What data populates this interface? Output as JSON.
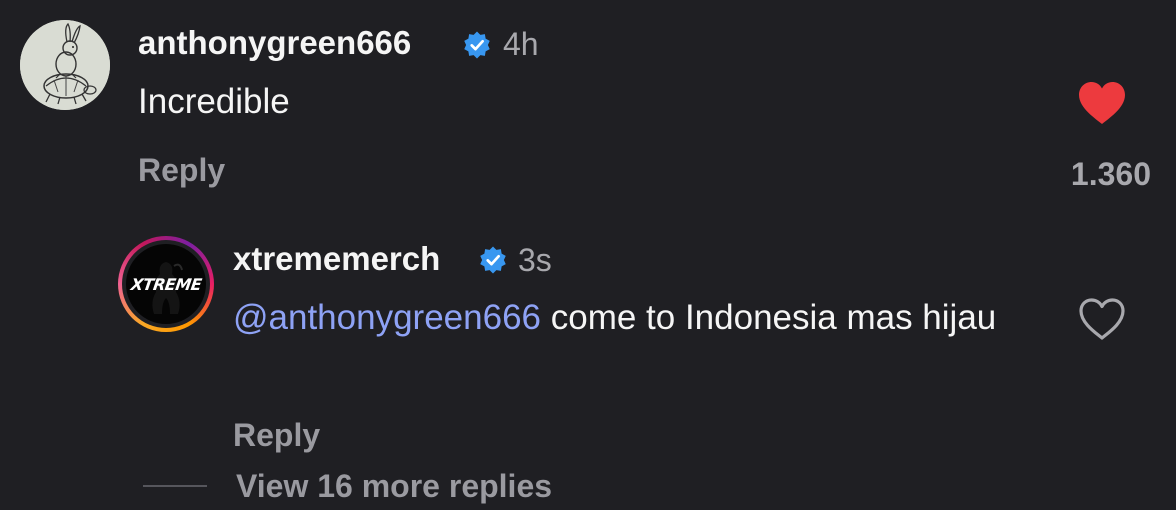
{
  "colors": {
    "background": "#1f1f23",
    "primary_text": "#f5f5f5",
    "secondary_text": "#a8a8ad",
    "mention": "#8ea2f5",
    "verified_badge": "#3897f0",
    "liked_heart": "#ed3a3e"
  },
  "comments": [
    {
      "username": "anthonygreen666",
      "verified": true,
      "timestamp": "4h",
      "text": "Incredible",
      "reply_label": "Reply",
      "liked": true,
      "like_icon": "heart-filled-icon",
      "like_count": "1.360",
      "avatar_icon": "rabbit-on-turtle-drawing"
    },
    {
      "username": "xtrememerch",
      "verified": true,
      "timestamp": "3s",
      "mention": "@anthonygreen666",
      "text_rest": " come to Indonesia mas hijau",
      "reply_label": "Reply",
      "liked": false,
      "like_icon": "heart-outline-icon",
      "avatar_logo_text": "XTREME",
      "has_story_ring": true
    }
  ],
  "view_more": "View 16 more replies"
}
